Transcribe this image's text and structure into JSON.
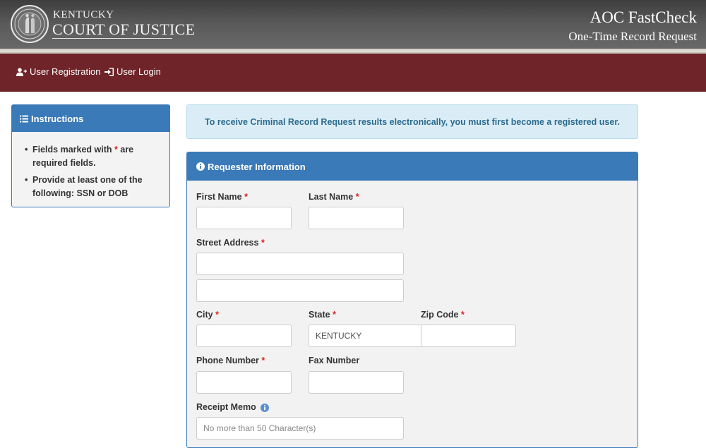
{
  "header": {
    "org_line1": "KENTUCKY",
    "org_line2": "COURT OF JUSTICE",
    "app_title": "AOC FastCheck",
    "app_subtitle": "One-Time Record Request"
  },
  "nav": {
    "register_label": "User Registration",
    "login_label": "User Login"
  },
  "instructions": {
    "title": "Instructions",
    "items": [
      {
        "pre": "Fields marked with ",
        "star": "*",
        "post": " are required fields."
      },
      {
        "text": "Provide at least one of the following: SSN or DOB"
      }
    ]
  },
  "alert": {
    "message": "To receive Criminal Record Request results electronically, you must first become a registered user."
  },
  "requester": {
    "title": "Requester Information",
    "required_mark": "*",
    "first_name_label": "First Name",
    "last_name_label": "Last Name",
    "street_label": "Street Address",
    "city_label": "City",
    "state_label": "State",
    "state_value": "KENTUCKY",
    "zip_label": "Zip Code",
    "phone_label": "Phone Number",
    "fax_label": "Fax Number",
    "memo_label": "Receipt Memo",
    "memo_placeholder": "No more than 50 Character(s)"
  },
  "colors": {
    "nav_bg": "#6e2428",
    "panel_blue": "#3a7ab8",
    "required_red": "#d9231f",
    "alert_bg": "#daedf6"
  },
  "icons": {
    "seal": "kentucky-seal-icon",
    "register": "user-plus-icon",
    "login": "sign-in-icon",
    "instructions": "list-icon",
    "requester": "info-circle-icon",
    "memo": "info-circle-icon"
  }
}
